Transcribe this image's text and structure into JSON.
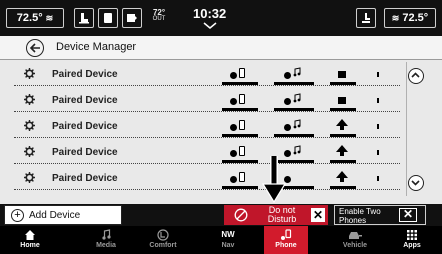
{
  "status_bar": {
    "temp_left": "72.5°",
    "outside_temp": "72°",
    "outside_label": "OUT",
    "clock": "10:32",
    "temp_right": "72.5°",
    "icons": [
      "heated-seat-icon",
      "driver-seat-icon",
      "passenger-seat-icon",
      "rear-defrost-icon",
      "chevron-down-icon",
      "fan-icon",
      "climate-icon"
    ]
  },
  "header": {
    "title": "Device Manager",
    "back_icon": "back-arrow-icon"
  },
  "devices": [
    {
      "name": "Paired Device",
      "status_icons": [
        "phone-connected-icon",
        "audio-connected-icon",
        "battery-icon",
        "signal-icon"
      ]
    },
    {
      "name": "Paired Device",
      "status_icons": [
        "phone-connected-icon",
        "audio-connected-icon",
        "battery-icon",
        "signal-icon"
      ]
    },
    {
      "name": "Paired Device",
      "status_icons": [
        "phone-connected-icon",
        "audio-connected-icon",
        "signal-strength-icon",
        "signal-icon"
      ]
    },
    {
      "name": "Paired Device",
      "status_icons": [
        "phone-connected-icon",
        "audio-connected-icon",
        "signal-strength-icon",
        "signal-icon"
      ]
    },
    {
      "name": "Paired Device",
      "status_icons": [
        "phone-connected-icon",
        "audio-connected-icon",
        "signal-strength-icon",
        "signal-icon"
      ]
    }
  ],
  "actions": {
    "add_device": "Add Device",
    "do_not_disturb": "Do not Disturb",
    "do_not_disturb_toggle": "✕",
    "enable_two_phones": "Enable Two Phones",
    "enable_two_phones_toggle": "✕"
  },
  "nav": {
    "home": "Home",
    "media": "Media",
    "comfort": "Comfort",
    "nav_top": "NW",
    "nav": "Nav",
    "phone": "Phone",
    "vehicle": "Vehicle",
    "apps": "Apps"
  },
  "colors": {
    "accent_red": "#c0162a",
    "nav_active": "#d21b2c",
    "bar_black": "#111111"
  }
}
